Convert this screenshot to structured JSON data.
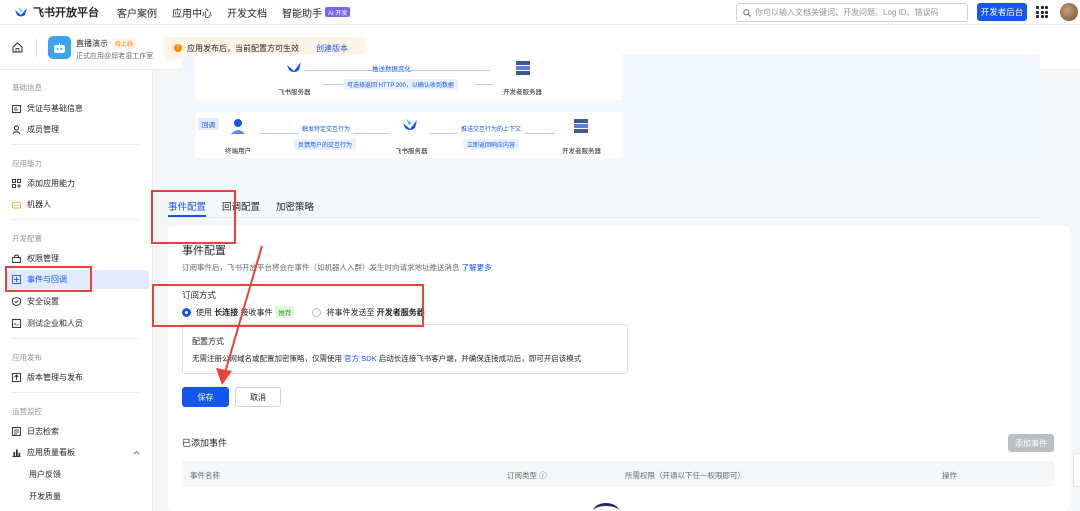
{
  "topbar": {
    "brand": "飞书开放平台",
    "nav": [
      "客户案例",
      "应用中心",
      "开发文档",
      "智能助手"
    ],
    "ai_badge": "AI 开发",
    "search_placeholder": "你可以输入文档关键词、开发问题、Log ID、错误码",
    "dev_console": "开发者后台"
  },
  "appbar": {
    "app_name": "直播演示",
    "status": "待上线",
    "app_sub": "正式应用@邱老湿工作室",
    "notice": "应用发布后，当前配置方可生效",
    "notice_link": "创建版本"
  },
  "sidebar": {
    "groups": {
      "basic": "基础信息",
      "ability": "应用能力",
      "dev": "开发配置",
      "release": "应用发布",
      "ops": "运营监控"
    },
    "items": {
      "credentials": "凭证与基础信息",
      "members": "成员管理",
      "add_ability": "添加应用能力",
      "bot": "机器人",
      "permissions": "权限管理",
      "events": "事件与回调",
      "security": "安全设置",
      "test_org": "测试企业和人员",
      "versions": "版本管理与发布",
      "logs": "日志检索",
      "quality": "应用质量看板",
      "feedback": "用户反馈",
      "dev_quality": "开发质量"
    }
  },
  "diagram": {
    "top_arrow_label": "推送数据变化",
    "top_return_label": "可选择返回 HTTP 200，以确认收到数据",
    "feishu_server": "飞书服务器",
    "dev_server": "开发者服务器",
    "callback_tag": "回调",
    "end_user": "终端用户",
    "trigger_label": "触发特定交互行为",
    "feedback_label": "反馈用户的交互行为",
    "push_context_label": "推送交互行为的上下文",
    "return_content_label": "立即返回响应内容"
  },
  "tabs": [
    "事件配置",
    "回调配置",
    "加密策略"
  ],
  "config": {
    "title": "事件配置",
    "desc": "订阅事件后，飞书开放平台将会在事件（如机器人入群）发生时向请求地址推送消息",
    "desc_link": "了解更多",
    "sub_title": "订阅方式",
    "option1_prefix": "使用",
    "option1_bold": "长连接",
    "option1_suffix": "接收事件",
    "recommend": "推荐",
    "option2_prefix": "将事件发送至",
    "option2_bold": "开发者服务器",
    "info_title": "配置方式",
    "info_text_1": "无需注册公网域名或配置加密策略，仅需使用",
    "info_link": "官方 SDK",
    "info_text_2": "启动长连接飞书客户端，并确保连接成功后，即可开启该模式",
    "save": "保存",
    "cancel": "取消"
  },
  "events": {
    "title": "已添加事件",
    "add": "添加事件",
    "columns": [
      "事件名称",
      "订阅类型 ⓘ",
      "所需权限（开通以下任一权限即可）",
      "操作"
    ]
  }
}
